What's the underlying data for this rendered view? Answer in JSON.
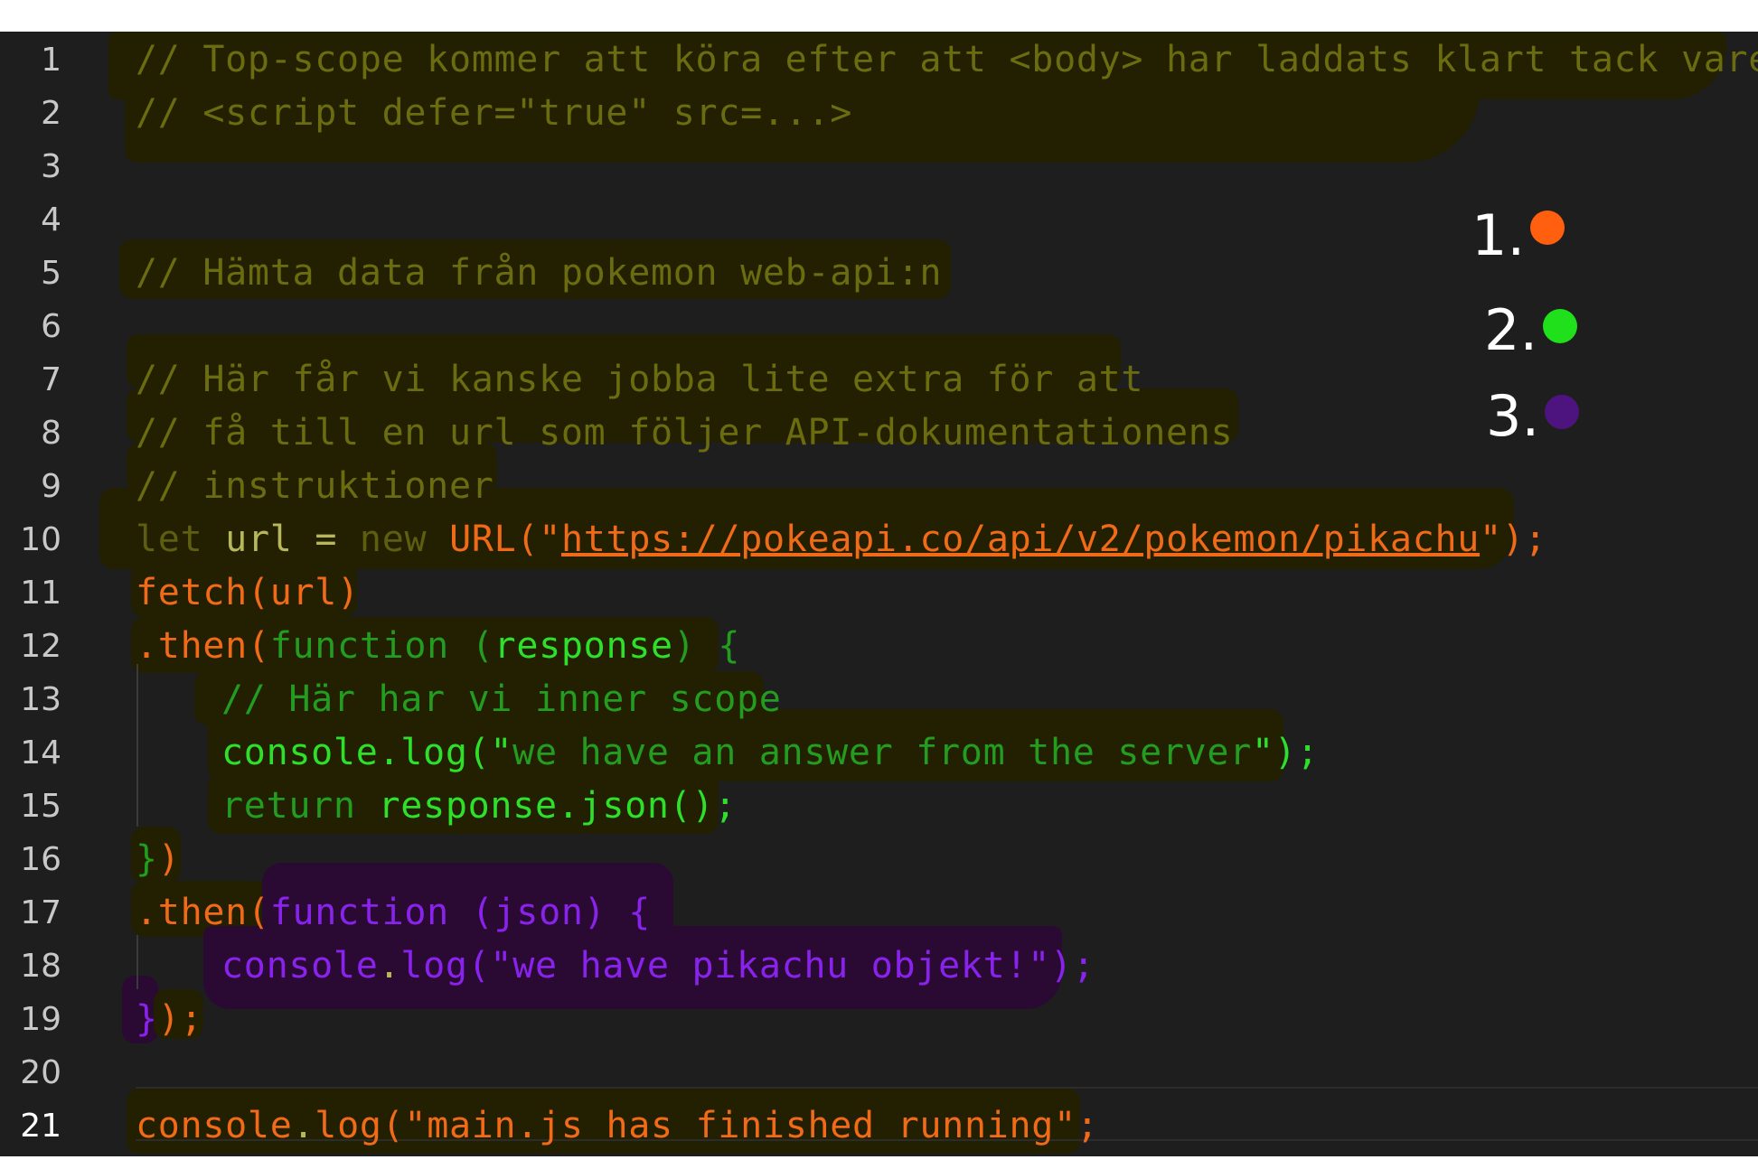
{
  "editor": {
    "line_numbers": [
      "1",
      "2",
      "3",
      "4",
      "5",
      "6",
      "7",
      "8",
      "9",
      "10",
      "11",
      "12",
      "13",
      "14",
      "15",
      "16",
      "17",
      "18",
      "19",
      "20",
      "21"
    ],
    "active_line": "21",
    "lines": {
      "l1": "// Top-scope kommer att köra efter att <body> har laddats klart tack vare",
      "l2": "// <script defer=\"true\" src=...>",
      "l5": "// Hämta data från pokemon web-api:n",
      "l7": "// Här får vi kanske jobba lite extra för att",
      "l8": "// få till en url som följer API-dokumentationens",
      "l9": "// instruktioner",
      "l10": {
        "kw_let": "let",
        "var_url": "url",
        "eq": "=",
        "kw_new": "new",
        "fn_url": "URL(\"",
        "url": "https://pokeapi.co/api/v2/pokemon/pikachu",
        "end": "\");"
      },
      "l11": "fetch(url)",
      "l12": {
        "then": ".then(",
        "function": "function",
        "paren_open": " (",
        "param": "response",
        "paren_close": ") {"
      },
      "l13": "// Här har vi inner scope",
      "l14": {
        "call": "console.log(\"",
        "text": "we have an answer from the server",
        "end": "\");"
      },
      "l15": {
        "kw": "return",
        "expr": "response.json();"
      },
      "l16": {
        "brace": "}",
        "paren": ")"
      },
      "l17": {
        "then": ".then(",
        "rest": "function (json) {"
      },
      "l18": {
        "call": "console",
        "dot": ".",
        "log": "log",
        "open": "(\"",
        "text": "we have pikachu objekt!",
        "end": "\");"
      },
      "l19": {
        "brace": "}",
        "end": ");"
      },
      "l21": {
        "call": "console",
        "dot": ".",
        "log": "log(\"main.js has finished running\";"
      }
    }
  },
  "legend": [
    {
      "label": "1.",
      "color": "#ff5f0f"
    },
    {
      "label": "2.",
      "color": "#1fe01a"
    },
    {
      "label": "3.",
      "color": "#4d1480"
    }
  ],
  "colors": {
    "background": "#1e1e1e",
    "comment": "#6b6b10",
    "orange": "#f06a18",
    "green": "#2ee02a",
    "purple": "#8a22ee"
  }
}
